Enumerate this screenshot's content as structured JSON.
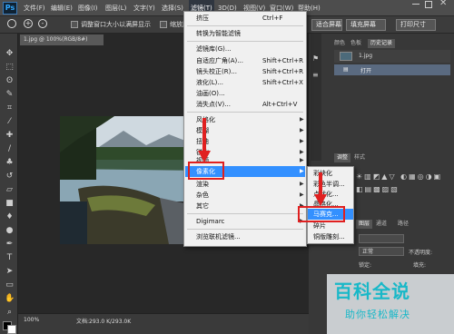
{
  "app": {
    "logo": "Ps"
  },
  "menubar": {
    "items": [
      "文件(F)",
      "编辑(E)",
      "图像(I)",
      "图层(L)",
      "文字(Y)",
      "选择(S)",
      "滤镜(T)",
      "3D(D)",
      "视图(V)",
      "窗口(W)",
      "帮助(H)"
    ]
  },
  "options": {
    "check1_label": "调整窗口大小以满屏显示",
    "check2_label": "缩放所有窗口",
    "btn_fit": "适合屏幕",
    "btn_fill": "填充屏幕",
    "btn_print": "打印尺寸"
  },
  "document": {
    "tab_title": "1.jpg @ 100%(RGB/8#)",
    "zoom": "100%",
    "doc_info": "文档:293.0 K/293.0K"
  },
  "filter_menu": {
    "last_filter": "挤压",
    "last_filter_shortcut": "Ctrl+F",
    "smart": "转换为智能滤镜",
    "gallery": "滤镜库(G)...",
    "adaptive": "自适应广角(A)...",
    "adaptive_shortcut": "Shift+Ctrl+R",
    "lens": "镜头校正(R)...",
    "lens_shortcut": "Shift+Ctrl+R",
    "liquify": "液化(L)...",
    "liquify_shortcut": "Shift+Ctrl+X",
    "oil": "油画(O)...",
    "vanish": "消失点(V)...",
    "vanish_shortcut": "Alt+Ctrl+V",
    "groups": [
      "风格化",
      "模糊",
      "扭曲",
      "锐化",
      "视频",
      "像素化",
      "渲染",
      "杂色",
      "其它"
    ],
    "digimarc": "Digimarc",
    "browse": "浏览联机滤镜..."
  },
  "pixelate_submenu": {
    "items": [
      "彩块化",
      "彩色半调...",
      "点状化...",
      "晶格化...",
      "马赛克...",
      "碎片",
      "铜版雕刻..."
    ],
    "selected": "马赛克..."
  },
  "panels": {
    "tabs_top": [
      "颜色",
      "色板",
      "历史记录"
    ],
    "history_doc": "1.jpg",
    "history_step": "打开",
    "tabs_mid": [
      "调整",
      "样式"
    ],
    "tabs_bottom": [
      "图层",
      "通道",
      "路径"
    ],
    "blend_mode": "正常",
    "opacity_label": "不透明度:",
    "lock_label": "锁定:",
    "fill_label": "填充:"
  },
  "watermark": {
    "title": "百科全说",
    "subtitle": "助你轻松解决"
  },
  "colors": {
    "highlight": "#3390ff",
    "annotation": "#e02020",
    "brand": "#31a8ff"
  }
}
